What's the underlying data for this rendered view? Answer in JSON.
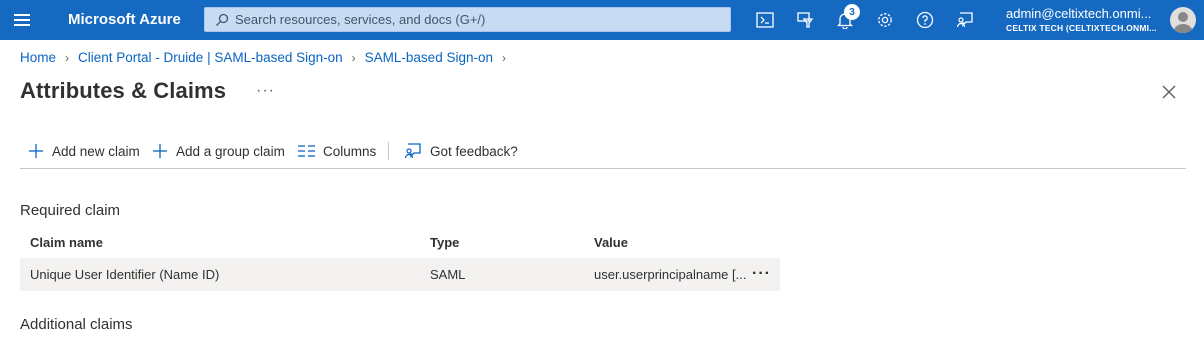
{
  "topbar": {
    "brand": "Microsoft Azure",
    "search_placeholder": "Search resources, services, and docs (G+/)",
    "notification_count": "3",
    "account_email": "admin@celtixtech.onmi...",
    "account_tenant": "CELTIX TECH (CELTIXTECH.ONMI...",
    "icons": [
      "cloud-shell-icon",
      "directory-filter-icon",
      "bell-icon",
      "gear-icon",
      "help-icon",
      "feedback-icon"
    ]
  },
  "breadcrumb": {
    "items": [
      "Home",
      "Client Portal - Druide | SAML-based Sign-on",
      "SAML-based Sign-on"
    ]
  },
  "page": {
    "title": "Attributes & Claims",
    "more": "···"
  },
  "commands": {
    "add_new_claim": "Add new claim",
    "add_group_claim": "Add a group claim",
    "columns": "Columns",
    "feedback": "Got feedback?"
  },
  "required": {
    "heading": "Required claim",
    "columns": [
      "Claim name",
      "Type",
      "Value"
    ],
    "rows": [
      {
        "name": "Unique User Identifier (Name ID)",
        "type": "SAML",
        "value": "user.userprincipalname [...",
        "more": "···"
      }
    ]
  },
  "additional": {
    "heading": "Additional claims"
  },
  "colors": {
    "topbar": "#1669c1",
    "link": "#0a64c2",
    "row_bg": "#f3f2f1"
  }
}
